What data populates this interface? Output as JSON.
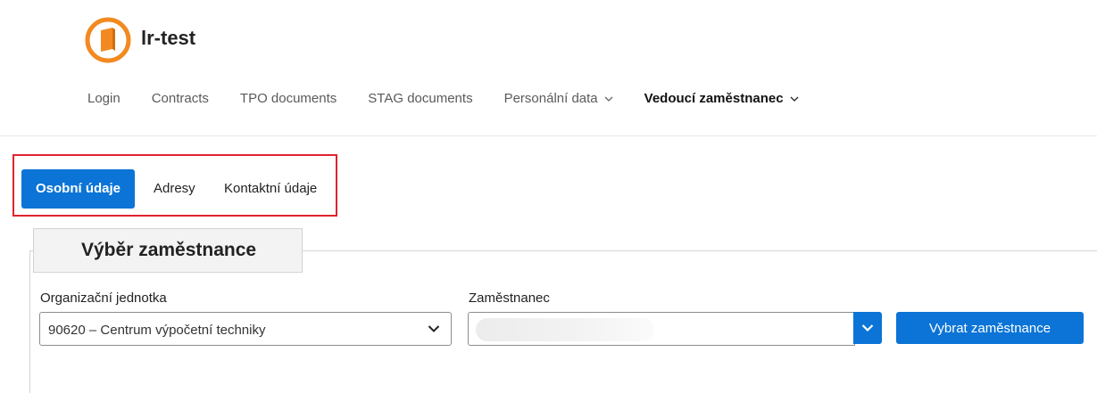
{
  "app": {
    "title": "lr-test",
    "brand_color": "#f28a21"
  },
  "nav": {
    "items": [
      {
        "label": "Login",
        "has_dropdown": false,
        "active": false
      },
      {
        "label": "Contracts",
        "has_dropdown": false,
        "active": false
      },
      {
        "label": "TPO documents",
        "has_dropdown": false,
        "active": false
      },
      {
        "label": "STAG documents",
        "has_dropdown": false,
        "active": false
      },
      {
        "label": "Personální data",
        "has_dropdown": true,
        "active": false
      },
      {
        "label": "Vedoucí zaměstnanec",
        "has_dropdown": true,
        "active": true
      }
    ]
  },
  "tabs": {
    "items": [
      {
        "label": "Osobní údaje",
        "active": true
      },
      {
        "label": "Adresy",
        "active": false
      },
      {
        "label": "Kontaktní údaje",
        "active": false
      }
    ],
    "highlight_color": "#e0232e"
  },
  "section": {
    "title": "Výběr zaměstnance"
  },
  "form": {
    "org_unit": {
      "label": "Organizační jednotka",
      "value": "90620 – Centrum výpočetní techniky"
    },
    "employee": {
      "label": "Zaměstnanec",
      "value": ""
    },
    "submit_label": "Vybrat zaměstnance"
  },
  "colors": {
    "accent": "#0b74d6",
    "text": "#1f1f1f"
  },
  "icons": {
    "logo": "book-logo-icon",
    "dropdown": "chevron-down-icon"
  }
}
